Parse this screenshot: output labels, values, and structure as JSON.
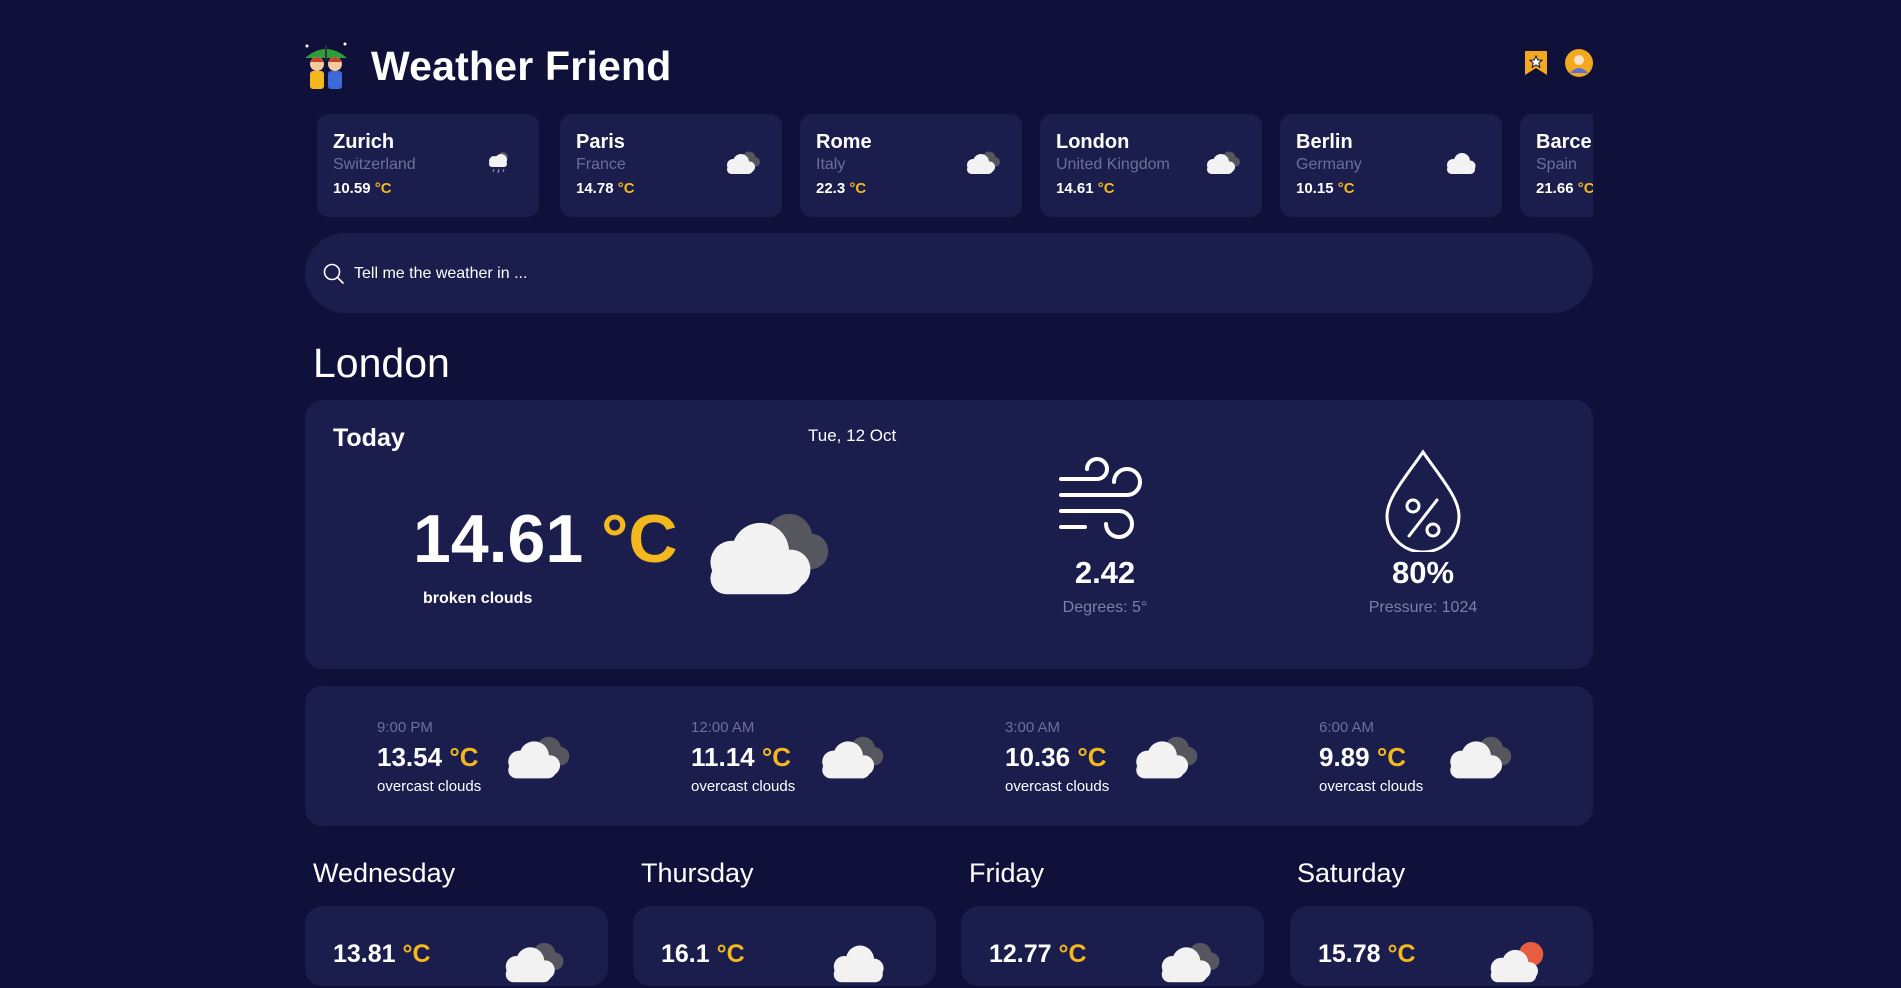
{
  "app": {
    "title": "Weather Friend"
  },
  "cities": [
    {
      "name": "Zurich",
      "country": "Switzerland",
      "temp": "10.59",
      "unit": "°C",
      "icon": "rain-cloud-icon"
    },
    {
      "name": "Paris",
      "country": "France",
      "temp": "14.78",
      "unit": "°C",
      "icon": "cloudy-icon"
    },
    {
      "name": "Rome",
      "country": "Italy",
      "temp": "22.3",
      "unit": "°C",
      "icon": "cloudy-icon"
    },
    {
      "name": "London",
      "country": "United Kingdom",
      "temp": "14.61",
      "unit": "°C",
      "icon": "cloudy-icon"
    },
    {
      "name": "Berlin",
      "country": "Germany",
      "temp": "10.15",
      "unit": "°C",
      "icon": "cloud-icon"
    },
    {
      "name": "Barcelona",
      "country": "Spain",
      "temp": "21.66",
      "unit": "°C",
      "icon": "cloudy-icon"
    }
  ],
  "search": {
    "placeholder": "Tell me the weather in ..."
  },
  "current": {
    "city": "London",
    "label": "Today",
    "date": "Tue, 12 Oct",
    "temp": "14.61",
    "unit": "°C",
    "description": "broken clouds",
    "wind": {
      "value": "2.42",
      "sub": "Degrees: 5°"
    },
    "humidity": {
      "value": "80%",
      "sub": "Pressure: 1024"
    }
  },
  "hourly": [
    {
      "time": "9:00 PM",
      "temp": "13.54",
      "unit": "°C",
      "description": "overcast clouds"
    },
    {
      "time": "12:00 AM",
      "temp": "11.14",
      "unit": "°C",
      "description": "overcast clouds"
    },
    {
      "time": "3:00 AM",
      "temp": "10.36",
      "unit": "°C",
      "description": "overcast clouds"
    },
    {
      "time": "6:00 AM",
      "temp": "9.89",
      "unit": "°C",
      "description": "overcast clouds"
    }
  ],
  "days": [
    {
      "name": "Wednesday",
      "temp": "13.81",
      "unit": "°C",
      "icon": "cloudy-icon"
    },
    {
      "name": "Thursday",
      "temp": "16.1",
      "unit": "°C",
      "icon": "cloud-icon"
    },
    {
      "name": "Friday",
      "temp": "12.77",
      "unit": "°C",
      "icon": "cloudy-icon"
    },
    {
      "name": "Saturday",
      "temp": "15.78",
      "unit": "°C",
      "icon": "sun-cloud-icon"
    }
  ],
  "colors": {
    "background": "#10113a",
    "card": "#1b1d4d",
    "accent": "#f4b81f",
    "muted": "#6d6f98"
  }
}
